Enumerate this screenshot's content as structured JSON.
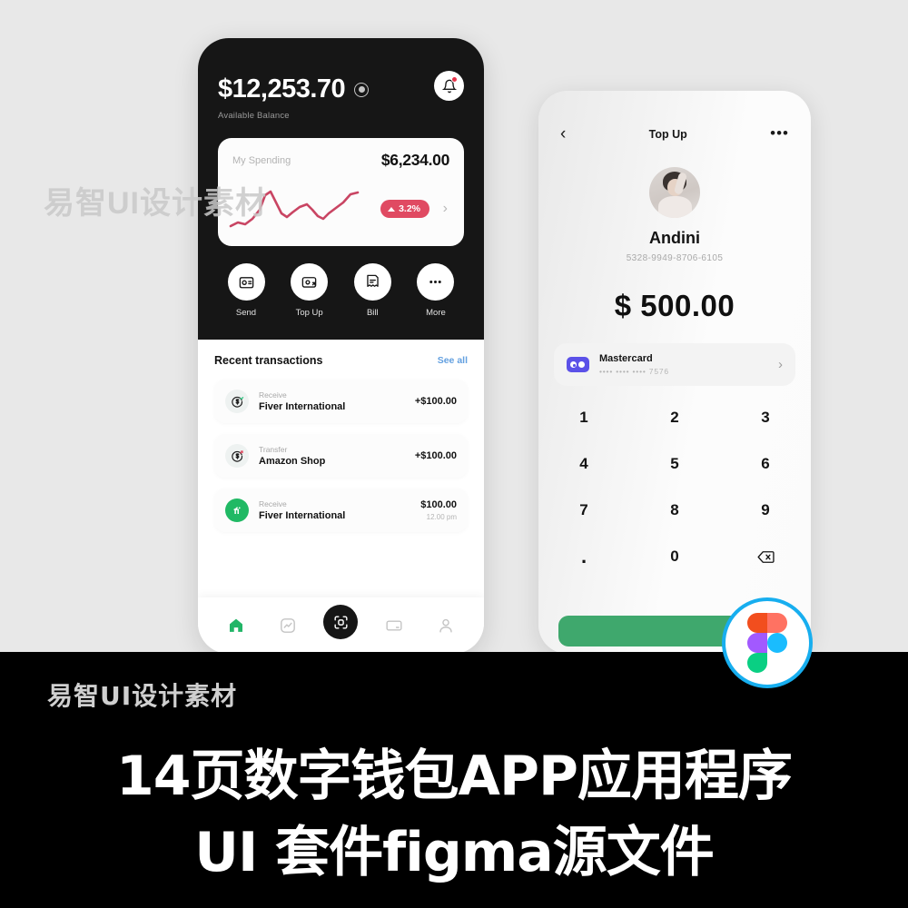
{
  "watermark": {
    "top_text": "易智UI设计素材",
    "banner_text": "易智UI设计素材"
  },
  "phone1": {
    "balance": {
      "amount": "$12,253.70",
      "label": "Available Balance",
      "eye_icon": "eye-toggle-icon",
      "bell_icon": "notification-bell-icon"
    },
    "spending_card": {
      "label": "My Spending",
      "amount": "$6,234.00",
      "change_badge": "3.2%",
      "chevron": "›",
      "accent_color": "#e04a62"
    },
    "actions": [
      {
        "label": "Send",
        "icon": "wallet-send-icon"
      },
      {
        "label": "Top Up",
        "icon": "wallet-topup-icon"
      },
      {
        "label": "Bill",
        "icon": "bill-receipt-icon"
      },
      {
        "label": "More",
        "icon": "more-dots-icon"
      }
    ],
    "transactions_section": {
      "title": "Recent transactions",
      "see_all": "See all"
    },
    "transactions": [
      {
        "type": "Receive",
        "name": "Fiver International",
        "amount": "+$100.00",
        "time": "",
        "icon": "receive-money-icon"
      },
      {
        "type": "Transfer",
        "name": "Amazon Shop",
        "amount": "+$100.00",
        "time": "",
        "icon": "transfer-money-icon"
      },
      {
        "type": "Receive",
        "name": "Fiver International",
        "amount": "$100.00",
        "time": "12.00 pm",
        "icon": "fiverr-logo-icon"
      }
    ],
    "nav": [
      {
        "name": "home",
        "icon": "home-icon",
        "active": true
      },
      {
        "name": "stats",
        "icon": "chart-icon",
        "active": false
      },
      {
        "name": "scan",
        "icon": "scan-qr-icon",
        "active": false
      },
      {
        "name": "cards",
        "icon": "card-icon",
        "active": false
      },
      {
        "name": "profile",
        "icon": "person-icon",
        "active": false
      }
    ]
  },
  "phone2": {
    "header": {
      "back_icon": "chevron-left-icon",
      "title": "Top Up",
      "menu_icon": "more-horizontal-icon"
    },
    "profile": {
      "name": "Andini",
      "card_number": "5328-9949-8706-6105"
    },
    "amount": "$ 500.00",
    "payment_method": {
      "name": "Mastercard",
      "masked_number": "•••• •••• •••• 7576",
      "chevron": "›",
      "brand_color": "#5b51e8"
    },
    "keypad": [
      "1",
      "2",
      "3",
      "4",
      "5",
      "6",
      "7",
      "8",
      "9",
      ".",
      "0",
      "⌫"
    ],
    "cta_color": "#3fa86d"
  },
  "figma_badge": {
    "icon": "figma-logo-icon",
    "ring_color": "#17aeef"
  },
  "banner": {
    "line1": "14页数字钱包APP应用程序",
    "line2": "UI 套件figma源文件"
  }
}
